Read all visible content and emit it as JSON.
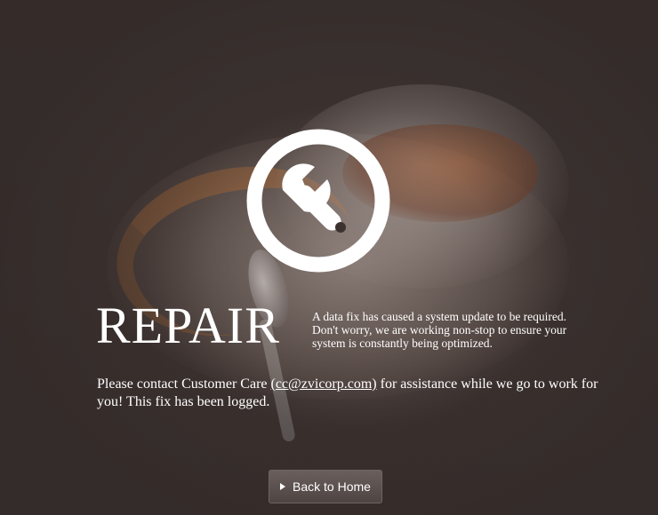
{
  "hero": {
    "icon": "wrench-icon",
    "title": "REPAIR",
    "description_lines": [
      "A data fix has caused a system update to be required.",
      "Don't worry, we are working non-stop to ensure your",
      "system is constantly being optimized."
    ]
  },
  "contact": {
    "before": "Please contact Customer Care ",
    "email_text": "(cc@zvicorp.com)",
    "after": " for assistance while we go to work for you! This fix has been logged."
  },
  "actions": {
    "home_label": "Back to Home",
    "home_icon": "play-icon"
  },
  "colors": {
    "background": "#3b3230",
    "text": "#ffffff",
    "button": "#5c5250"
  }
}
